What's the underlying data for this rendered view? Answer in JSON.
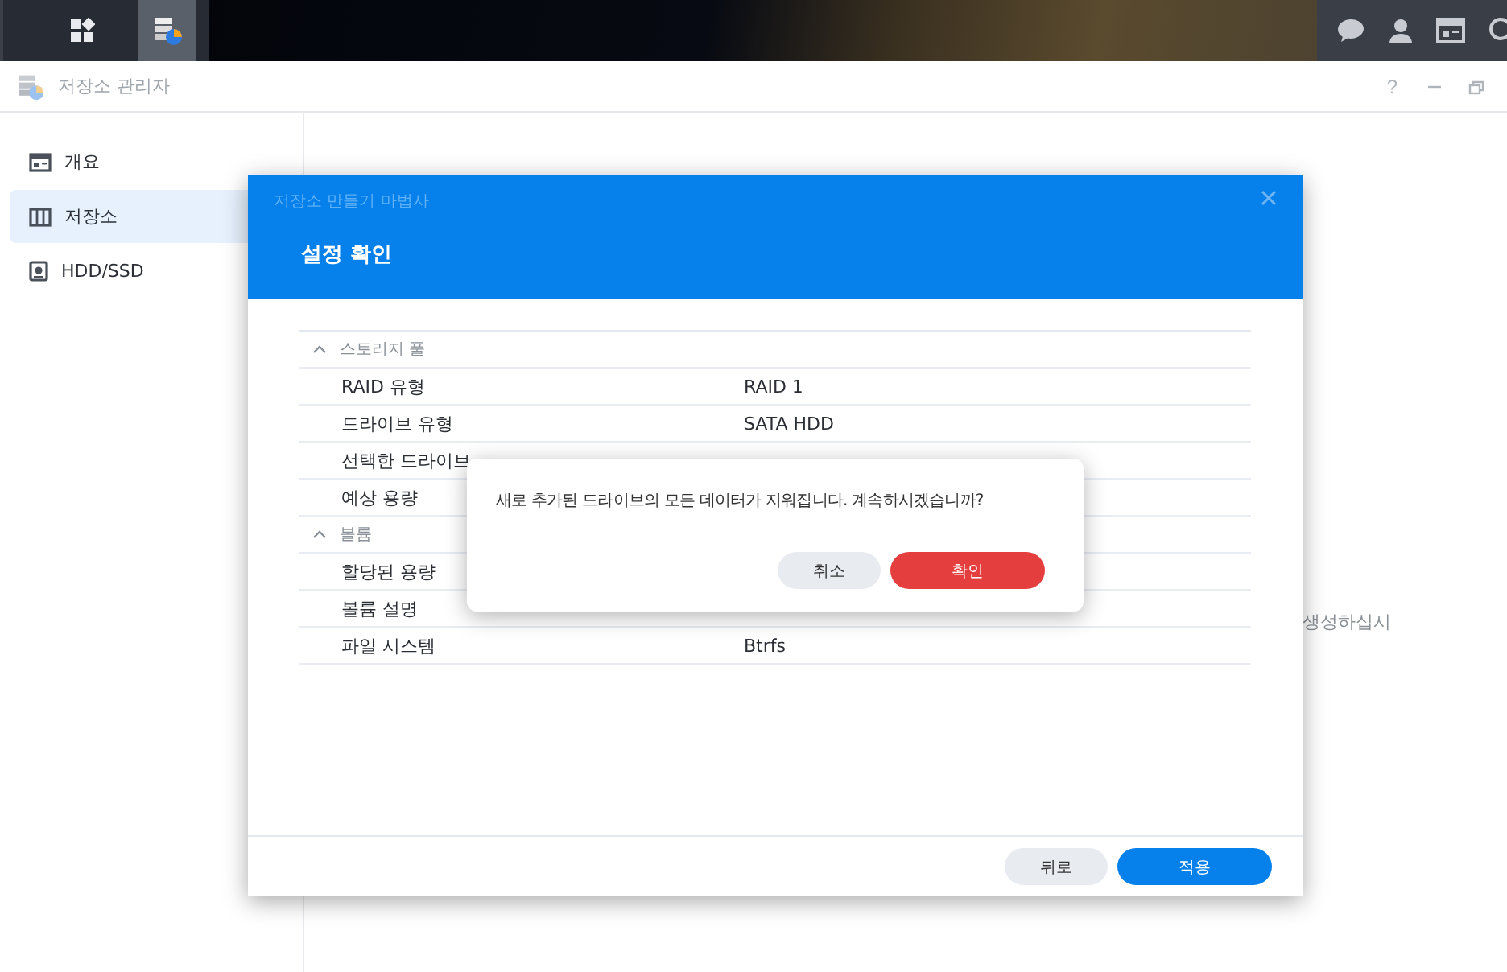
{
  "taskbar": {
    "buttons": [
      {
        "kind": "main-menu",
        "selected": false
      },
      {
        "kind": "storage-app",
        "selected": true
      }
    ],
    "tray": [
      {
        "kind": "chat"
      },
      {
        "kind": "user"
      },
      {
        "kind": "widgets"
      },
      {
        "kind": "search"
      }
    ]
  },
  "app_window": {
    "title": "저장소 관리자",
    "help": "?"
  },
  "sidebar": {
    "items": [
      {
        "label": "개요",
        "kind": "overview",
        "selected": false
      },
      {
        "label": "저장소",
        "kind": "storage",
        "selected": true
      },
      {
        "label": "HDD/SSD",
        "kind": "drive",
        "selected": false
      }
    ]
  },
  "main": {
    "partial_text": "생성하십시"
  },
  "wizard": {
    "title": "저장소 만들기 마법사",
    "heading": "설정 확인",
    "sections": [
      {
        "title": "스토리지 풀",
        "expanded": true,
        "rows": [
          {
            "label": "RAID 유형",
            "value": "RAID 1"
          },
          {
            "label": "드라이브 유형",
            "value": "SATA HDD"
          },
          {
            "label": "선택한 드라이브"
          },
          {
            "label": "예상 용량"
          }
        ]
      },
      {
        "title": "볼륨",
        "expanded": true,
        "rows": [
          {
            "label": "할당된 용량"
          },
          {
            "label": "볼륨 설명"
          },
          {
            "label": "파일 시스템",
            "value": "Btrfs"
          }
        ]
      }
    ],
    "buttons": [
      {
        "label": "뒤로",
        "kind": "secondary"
      },
      {
        "label": "적용",
        "kind": "primary"
      }
    ]
  },
  "confirm": {
    "message": "새로 추가된 드라이브의 모든 데이터가 지워집니다. 계속하시겠습니까?",
    "buttons": [
      {
        "label": "취소",
        "kind": "secondary"
      },
      {
        "label": "확인",
        "kind": "danger"
      }
    ]
  }
}
